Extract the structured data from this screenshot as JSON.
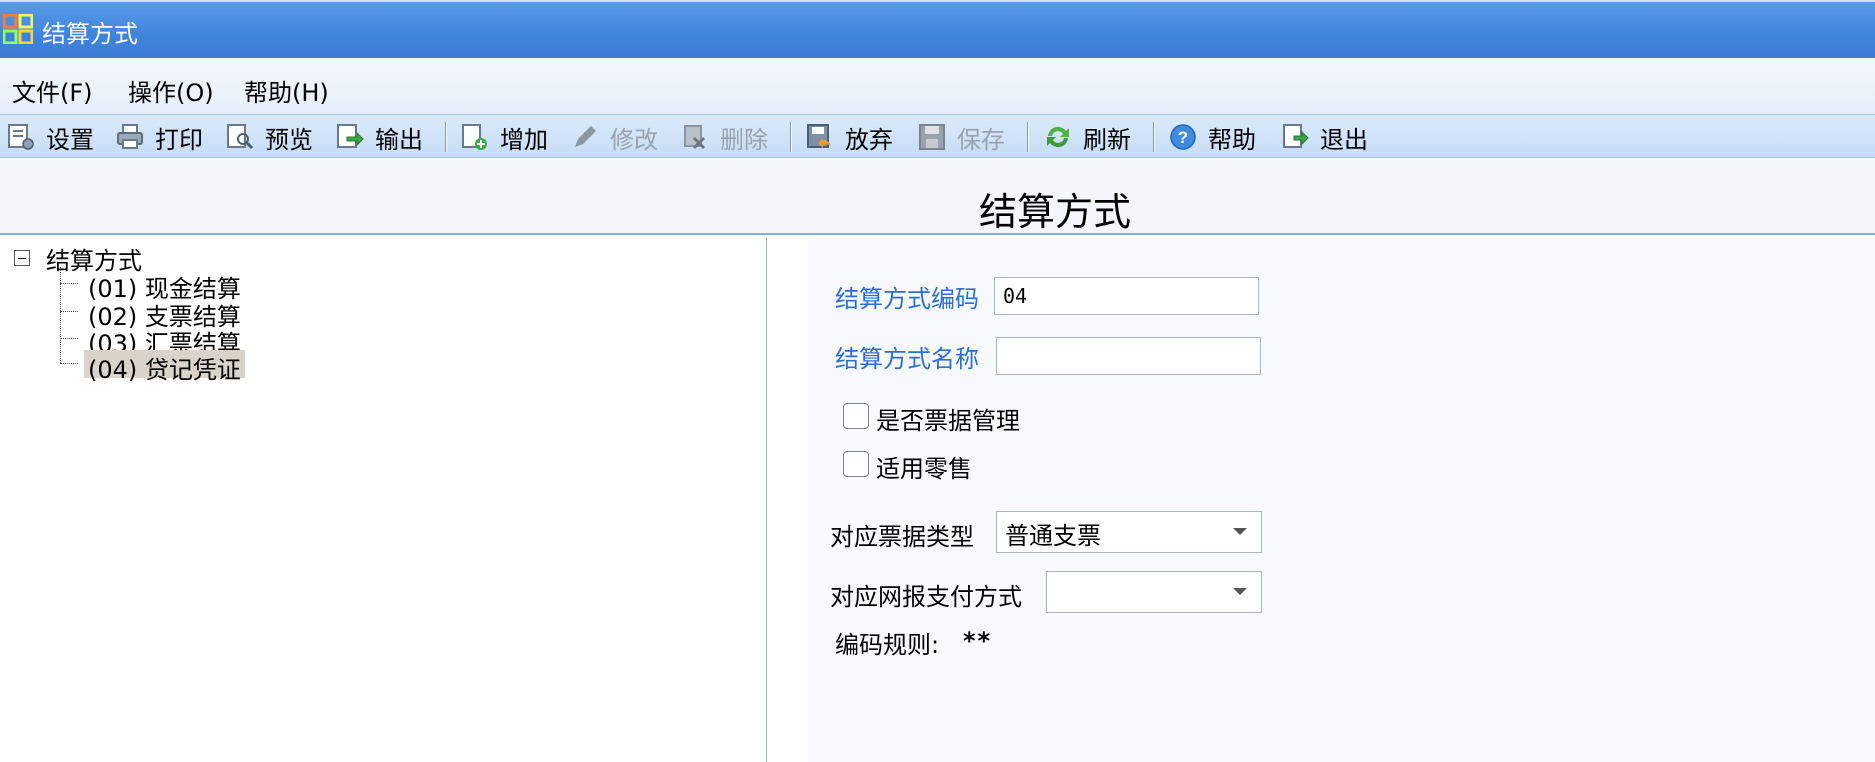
{
  "window": {
    "title": "结算方式"
  },
  "menu": [
    {
      "label": "文件(F)"
    },
    {
      "label": "操作(O)"
    },
    {
      "label": "帮助(H)"
    }
  ],
  "toolbar": {
    "settings": "设置",
    "print": "打印",
    "preview": "预览",
    "export": "输出",
    "add": "增加",
    "edit": "修改",
    "delete": "删除",
    "discard": "放弃",
    "save": "保存",
    "refresh": "刷新",
    "help": "帮助",
    "exit": "退出"
  },
  "page": {
    "title": "结算方式"
  },
  "tree": {
    "root": "结算方式",
    "items": [
      {
        "label": "(01) 现金结算"
      },
      {
        "label": "(02) 支票结算"
      },
      {
        "label": "(03) 汇票结算"
      },
      {
        "label": "(04) 贷记凭证",
        "selected": true
      }
    ]
  },
  "form": {
    "code_label": "结算方式编码",
    "code_value": "04",
    "name_label": "结算方式名称",
    "name_value": "",
    "bill_mgmt_label": "是否票据管理",
    "bill_mgmt_checked": false,
    "retail_label": "适用零售",
    "retail_checked": false,
    "bill_type_label": "对应票据类型",
    "bill_type_value": "普通支票",
    "net_pay_label": "对应网报支付方式",
    "net_pay_value": "",
    "rule_label": "编码规则:",
    "rule_value": "**"
  }
}
